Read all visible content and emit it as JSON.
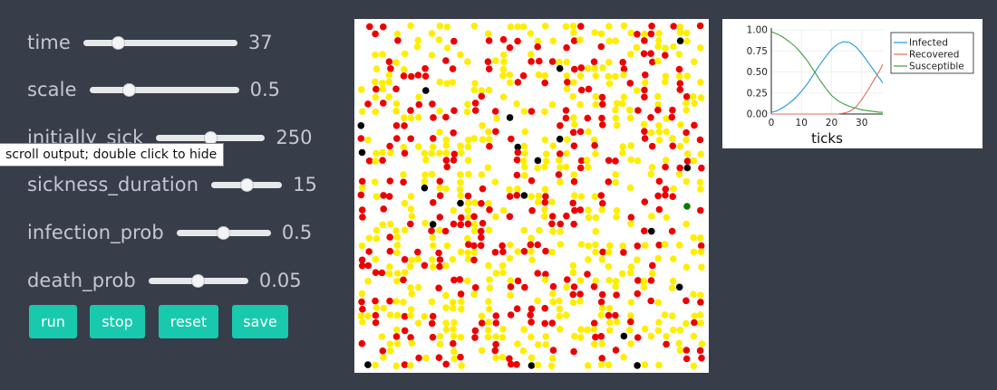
{
  "controls": {
    "sliders": [
      {
        "label": "time",
        "value": "37",
        "fraction": 0.2
      },
      {
        "label": "scale",
        "value": "0.5",
        "fraction": 0.24
      },
      {
        "label": "initially_sick",
        "value": "250",
        "fraction": 0.5
      },
      {
        "label": "sickness_duration",
        "value": "15",
        "fraction": 0.5
      },
      {
        "label": "infection_prob",
        "value": "0.5",
        "fraction": 0.5
      },
      {
        "label": "death_prob",
        "value": "0.05",
        "fraction": 0.5
      }
    ],
    "buttons": {
      "run": "run",
      "stop": "stop",
      "reset": "reset",
      "save": "save"
    },
    "tooltip": "scroll output; double click to hide"
  },
  "colors": {
    "background": "#373d49",
    "button": "#19c9ae",
    "susceptible_agent": "#ffee00",
    "infected_agent": "#ee0000",
    "dead_agent": "#000000",
    "recovered_agent": "#0a7a0a"
  },
  "plot": {
    "xlabel": "ticks",
    "xticks": [
      "0",
      "10",
      "20",
      "30"
    ],
    "yticks": [
      "0.00",
      "0.25",
      "0.50",
      "0.75",
      "1.00"
    ],
    "legend": [
      "Infected",
      "Recovered",
      "Susceptible"
    ]
  },
  "chart_data": {
    "type": "line",
    "xlabel": "ticks",
    "ylabel": "",
    "xlim": [
      0,
      37
    ],
    "ylim": [
      0,
      1
    ],
    "grid": true,
    "legend_position": "top-right",
    "series": [
      {
        "name": "Infected",
        "color": "#1f9ad6",
        "x": [
          0,
          2,
          4,
          6,
          8,
          10,
          12,
          14,
          16,
          18,
          20,
          22,
          24,
          26,
          28,
          30,
          32,
          34,
          36,
          37
        ],
        "values": [
          0.02,
          0.04,
          0.08,
          0.13,
          0.19,
          0.27,
          0.36,
          0.47,
          0.58,
          0.68,
          0.77,
          0.83,
          0.86,
          0.85,
          0.8,
          0.72,
          0.62,
          0.52,
          0.42,
          0.37
        ]
      },
      {
        "name": "Recovered",
        "color": "#e26f4f",
        "x": [
          0,
          4,
          8,
          12,
          16,
          18,
          20,
          22,
          24,
          26,
          28,
          30,
          32,
          34,
          36,
          37
        ],
        "values": [
          0,
          0,
          0,
          0,
          0,
          0,
          0,
          0,
          0.01,
          0.03,
          0.08,
          0.17,
          0.28,
          0.4,
          0.52,
          0.59
        ]
      },
      {
        "name": "Susceptible",
        "color": "#3aa03a",
        "x": [
          0,
          2,
          4,
          6,
          8,
          10,
          12,
          14,
          16,
          18,
          20,
          22,
          24,
          26,
          28,
          30,
          32,
          34,
          36,
          37
        ],
        "values": [
          0.98,
          0.95,
          0.91,
          0.86,
          0.8,
          0.72,
          0.63,
          0.52,
          0.41,
          0.31,
          0.22,
          0.16,
          0.12,
          0.09,
          0.07,
          0.05,
          0.04,
          0.03,
          0.02,
          0.02
        ]
      }
    ]
  }
}
